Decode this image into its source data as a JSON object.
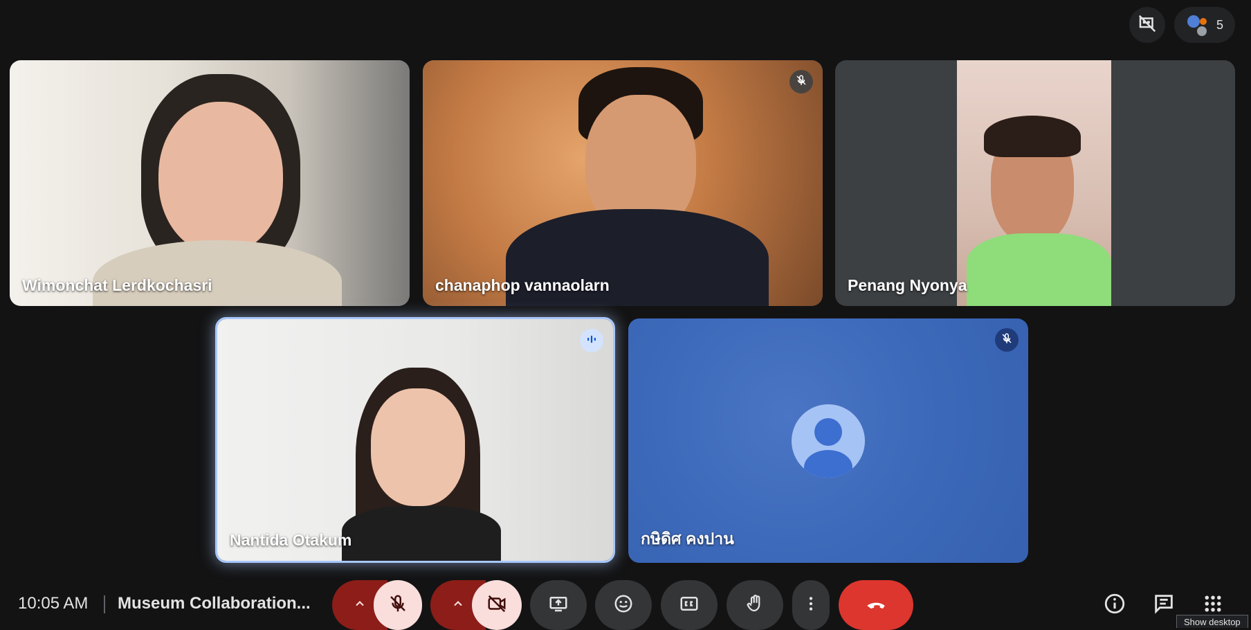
{
  "top_bar": {
    "participants_count": "5"
  },
  "tiles": [
    {
      "name": "Wimonchat Lerdkochasri",
      "muted": false
    },
    {
      "name": "chanaphop vannaolarn",
      "muted": true
    },
    {
      "name": "Penang Nyonya",
      "muted": false
    },
    {
      "name": "Nantida Otakum",
      "speaking": true
    },
    {
      "name": "กษิดิศ คงปาน",
      "muted": true
    }
  ],
  "bottom_bar": {
    "time": "10:05 AM",
    "meeting_title": "Museum Collaboration...",
    "tooltip": "Show desktop"
  },
  "colors": {
    "background": "#131314",
    "end_call": "#dc362e",
    "mic_off_bg": "#f9dedc",
    "avatar_tile": "#3d69ba",
    "speaking_border": "#a8c7fa"
  }
}
